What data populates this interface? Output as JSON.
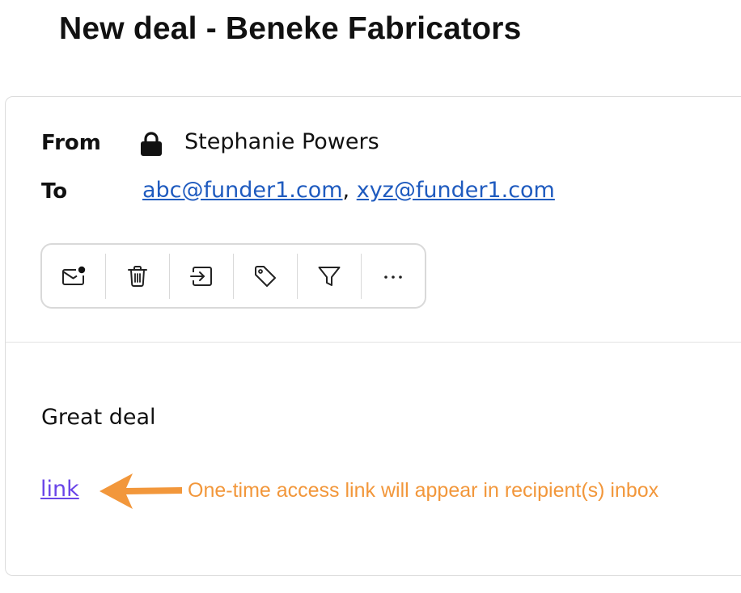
{
  "email": {
    "subject": "New deal - Beneke Fabricators",
    "from_label": "From",
    "from_name": "Stephanie Powers",
    "to_label": "To",
    "recipients": [
      "abc@funder1.com",
      "xyz@funder1.com"
    ],
    "recipient_separator": ", ",
    "body_text": "Great deal",
    "body_link": "link"
  },
  "toolbar": {
    "buttons": [
      {
        "icon": "mark-unread-icon",
        "label": "Mark as unread"
      },
      {
        "icon": "trash-icon",
        "label": "Delete"
      },
      {
        "icon": "move-icon",
        "label": "Move"
      },
      {
        "icon": "tag-icon",
        "label": "Tag"
      },
      {
        "icon": "filter-icon",
        "label": "Filter"
      },
      {
        "icon": "more-icon",
        "label": "More"
      }
    ]
  },
  "annotation": {
    "text": "One-time access link will appear in recipient(s) inbox",
    "color": "#F2973B"
  },
  "colors": {
    "link_blue": "#1F5BBF",
    "body_link_purple": "#6A45E8"
  }
}
